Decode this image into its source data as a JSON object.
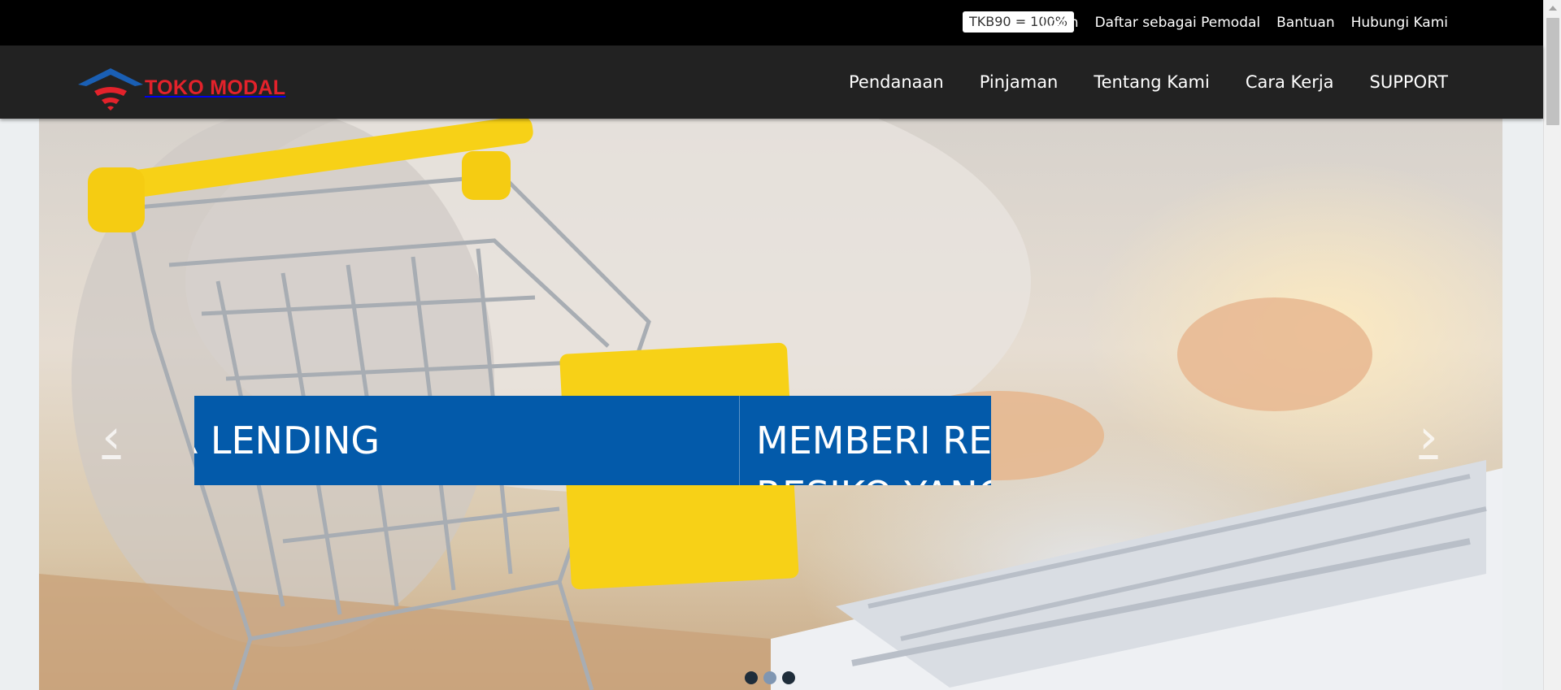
{
  "topbar": {
    "badge": "TKB90 = 100%",
    "links": [
      "Login",
      "Daftar sebagai Pemodal",
      "Bantuan",
      "Hubungi Kami"
    ]
  },
  "navbar": {
    "logo_text": "TOKO MODAL",
    "items": [
      "Pendanaan",
      "Pinjaman",
      "Tentang Kami",
      "Cara Kerja",
      "SUPPORT"
    ]
  },
  "hero": {
    "slide_text_left": "R LENDING",
    "slide_text_right_line1": "MEMBERI RET",
    "slide_text_right_line2": "RESIKO YANG",
    "prev_icon": "‹",
    "next_icon": "›",
    "indicator_count": 3,
    "active_indicator": 2
  },
  "colors": {
    "topbar": "#000000",
    "navbar": "#222222",
    "brand_red": "#e3222b",
    "brand_blue": "#1a5fb4",
    "slide_band": "#035aaa"
  }
}
